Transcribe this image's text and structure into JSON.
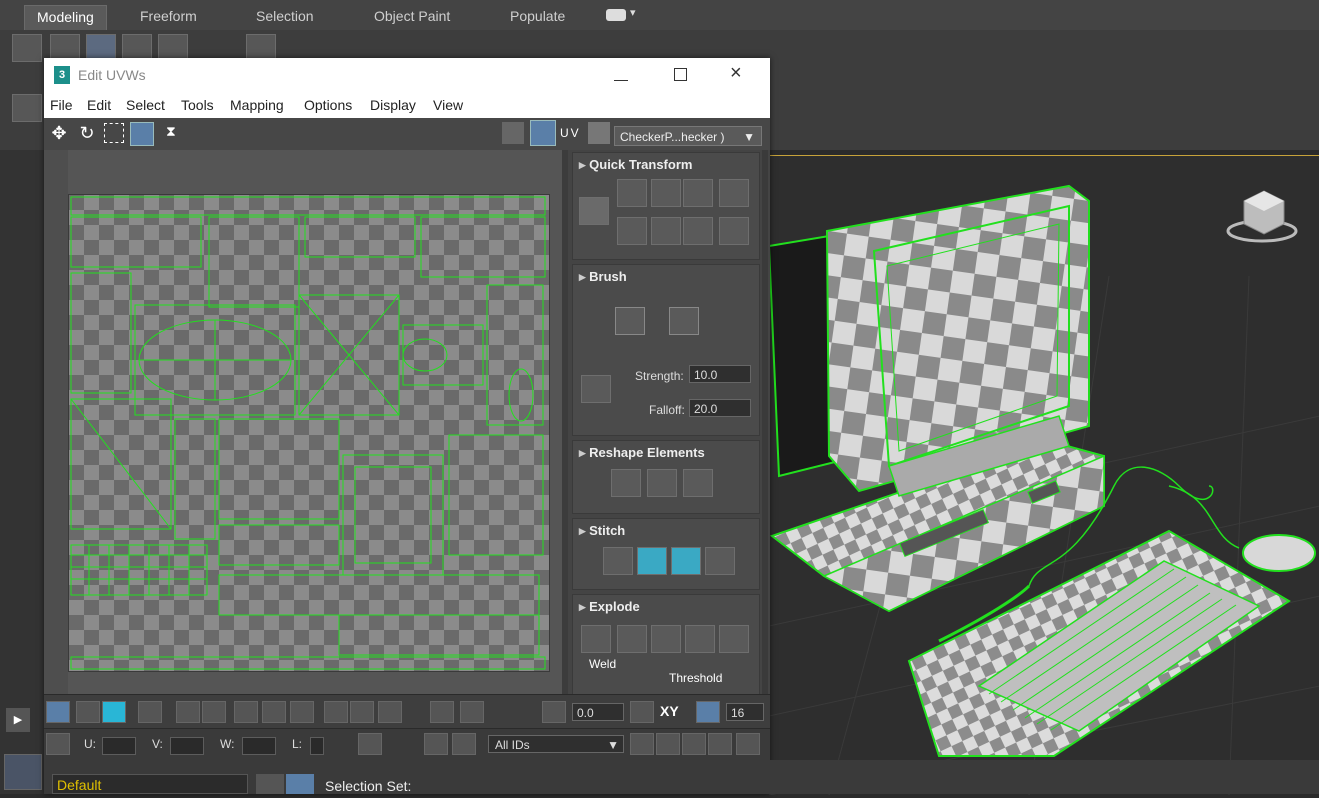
{
  "ribbon": {
    "tabs": [
      "Modeling",
      "Freeform",
      "Selection",
      "Object Paint",
      "Populate"
    ],
    "active_tab": "Modeling"
  },
  "editor": {
    "title": "Edit UVWs",
    "menu": [
      "File",
      "Edit",
      "Select",
      "Tools",
      "Mapping",
      "Options",
      "Display",
      "View"
    ],
    "uv_label": "UV",
    "texture_dropdown": "CheckerP...hecker )",
    "quick_transform": "Quick Transform",
    "brush": {
      "title": "Brush",
      "strength_label": "Strength:",
      "strength_value": "10.0",
      "falloff_label": "Falloff:",
      "falloff_value": "20.0"
    },
    "reshape": "Reshape Elements",
    "stitch": "Stitch",
    "explode": {
      "title": "Explode",
      "weld_label": "Weld",
      "threshold_label": "Threshold"
    },
    "bottom": {
      "angle_value": "0.0",
      "xy_label": "XY",
      "grid_value": "16",
      "u_label": "U:",
      "v_label": "V:",
      "w_label": "W:",
      "l_label": "L:",
      "ids_value": "All IDs"
    }
  },
  "status": {
    "layer": "Default",
    "selection_set_label": "Selection Set:"
  },
  "colors": {
    "wire": "#22e01e",
    "accent": "#29b6d6",
    "viewport_border": "#c7a33a"
  }
}
